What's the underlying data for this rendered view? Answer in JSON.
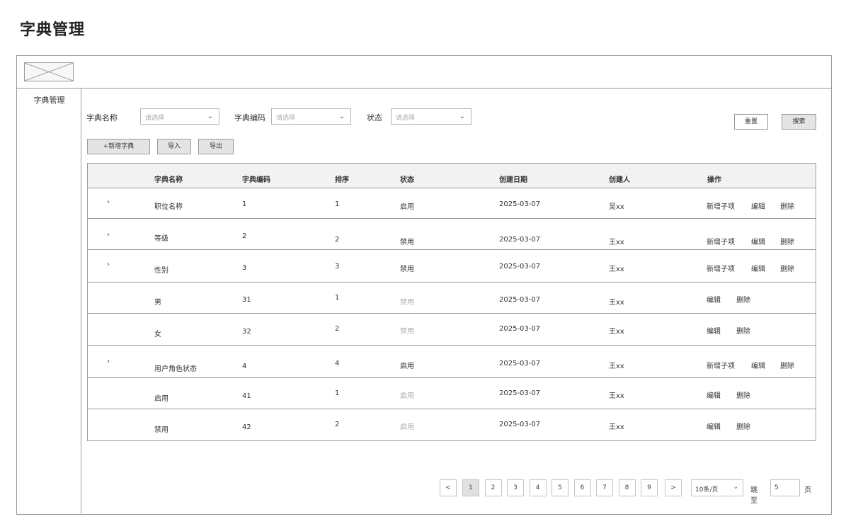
{
  "page": {
    "title": "字典管理"
  },
  "sidebar": {
    "items": [
      {
        "label": "字典管理"
      }
    ]
  },
  "filters": {
    "name": {
      "label": "字典名称",
      "placeholder": "请选择"
    },
    "code": {
      "label": "字典编码",
      "placeholder": "请选择"
    },
    "status": {
      "label": "状态",
      "placeholder": "请选择"
    }
  },
  "buttons": {
    "reset": "重置",
    "search": "搜索",
    "add": "+新增字典",
    "import": "导入",
    "export": "导出"
  },
  "table": {
    "columns": [
      "字典名称",
      "字典编码",
      "排序",
      "状态",
      "创建日期",
      "创建人",
      "操作"
    ],
    "expand_glyph": "›",
    "rows": [
      {
        "name": "职位名称",
        "code": "1",
        "sort": "1",
        "status": "启用",
        "date": "2025-03-07",
        "creator": "吴xx",
        "actions": [
          "新增子项",
          "编辑",
          "删除"
        ]
      },
      {
        "name": "等级",
        "code": "2",
        "sort": "2",
        "status": "禁用",
        "date": "2025-03-07",
        "creator": "王xx",
        "actions": [
          "新增子项",
          "编辑",
          "删除"
        ]
      },
      {
        "name": "性别",
        "code": "3",
        "sort": "3",
        "status": "禁用",
        "date": "2025-03-07",
        "creator": "王xx",
        "actions": [
          "新增子项",
          "编辑",
          "删除"
        ]
      },
      {
        "name": "男",
        "code": "31",
        "sort": "1",
        "status": "禁用",
        "date": "2025-03-07",
        "creator": "王xx",
        "actions": [
          "编辑",
          "删除"
        ]
      },
      {
        "name": "女",
        "code": "32",
        "sort": "2",
        "status": "禁用",
        "date": "2025-03-07",
        "creator": "王xx",
        "actions": [
          "编辑",
          "删除"
        ]
      },
      {
        "name": "用户角色状态",
        "code": "4",
        "sort": "4",
        "status": "启用",
        "date": "2025-03-07",
        "creator": "王xx",
        "actions": [
          "新增子项",
          "编辑",
          "删除"
        ]
      },
      {
        "name": "启用",
        "code": "41",
        "sort": "1",
        "status": "启用",
        "date": "2025-03-07",
        "creator": "王xx",
        "actions": [
          "编辑",
          "删除"
        ]
      },
      {
        "name": "禁用",
        "code": "42",
        "sort": "2",
        "status": "启用",
        "date": "2025-03-07",
        "creator": "王xx",
        "actions": [
          "编辑",
          "删除"
        ]
      }
    ]
  },
  "pagination": {
    "prev": "<",
    "next": ">",
    "pages": [
      "1",
      "2",
      "3",
      "4",
      "5",
      "6",
      "7",
      "8",
      "9"
    ],
    "current_page": "1",
    "page_size": "10条/页",
    "jump_label": "跳至",
    "jump_value": "5",
    "page_unit": "页"
  },
  "colors": {
    "border": "#9a9a9a",
    "header_bg": "#f2f2f2",
    "button_bg": "#e4e4e4",
    "muted_text": "#aaaaaa"
  },
  "icons": {
    "logo": "image-placeholder-icon",
    "dropdown": "chevron-down-icon",
    "expand": "chevron-right-icon"
  }
}
